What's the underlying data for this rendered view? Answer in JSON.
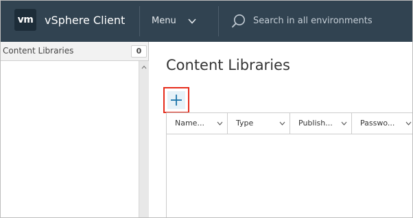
{
  "header": {
    "logo_text": "vm",
    "app_title": "vSphere Client",
    "menu_label": "Menu",
    "search_placeholder": "Search in all environments",
    "background_color": "#314351"
  },
  "left_panel": {
    "title": "Content Libraries",
    "count": "0"
  },
  "main": {
    "title": "Content Libraries",
    "add_button_icon": "plus-icon",
    "highlight_color": "#e62a1a",
    "grid": {
      "columns": [
        {
          "label": "Name..."
        },
        {
          "label": "Type"
        },
        {
          "label": "Publish..."
        },
        {
          "label": "Passwo..."
        }
      ]
    }
  }
}
